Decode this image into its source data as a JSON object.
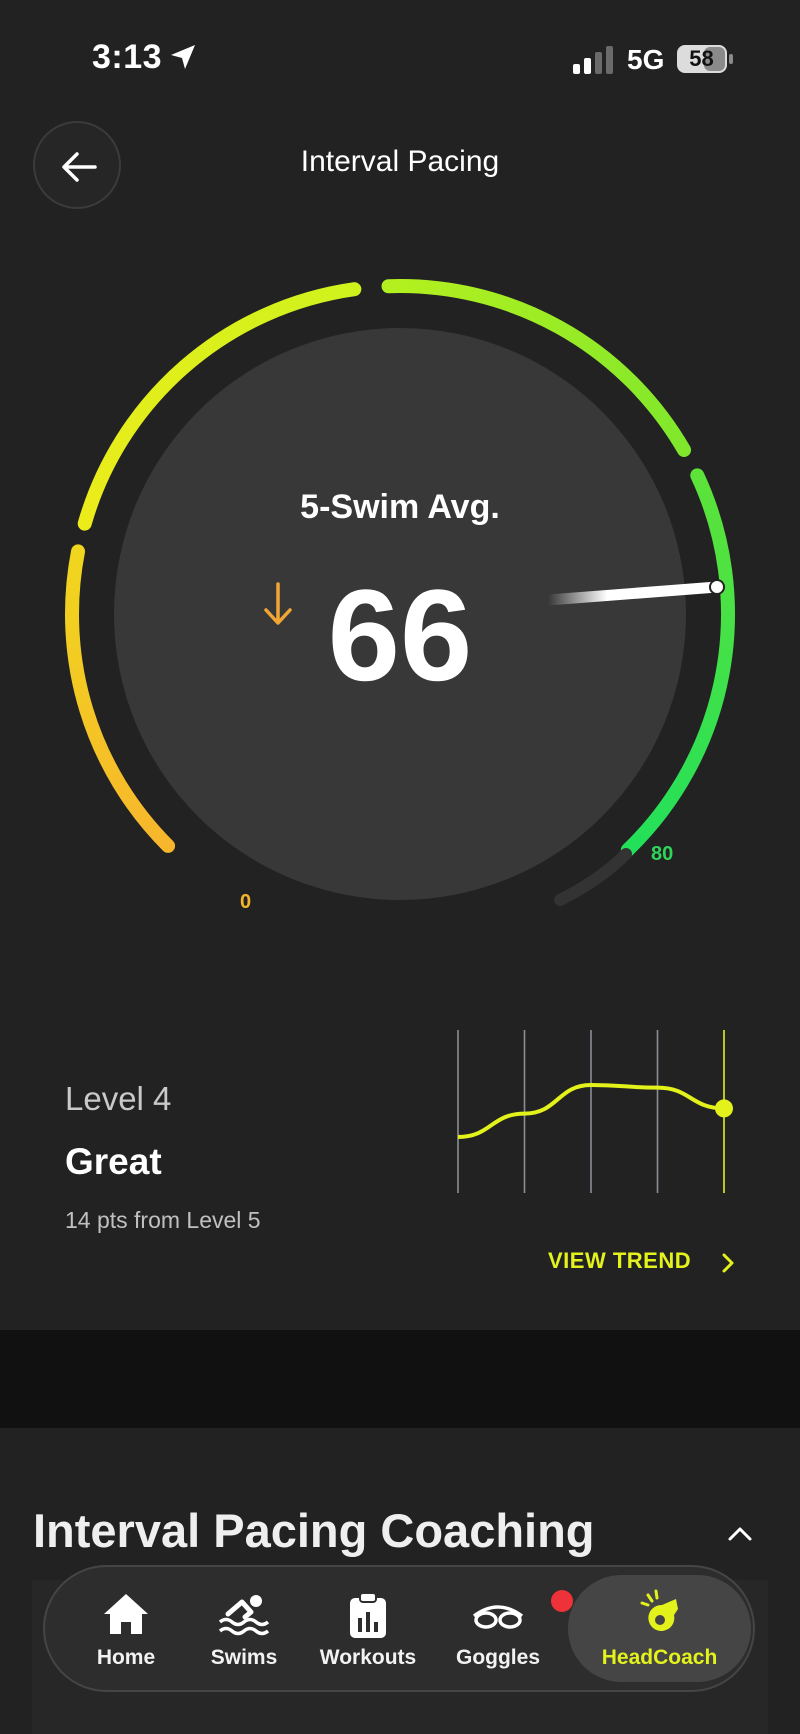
{
  "status_bar": {
    "time": "3:13",
    "network": "5G",
    "battery": "58"
  },
  "header": {
    "title": "Interval Pacing"
  },
  "gauge": {
    "label": "5-Swim Avg.",
    "value": "66",
    "min_label": "0",
    "max_label": "80",
    "trend": "down",
    "fraction_of_scale": 0.825,
    "colors": {
      "low": "#f7b62c",
      "mid": "#e6f51b",
      "high": "#22e05a",
      "needle": "#ffffff",
      "arrow": "#f3a534"
    }
  },
  "level": {
    "sublabel": "Level 4",
    "name": "Great",
    "points_to_next": "14 pts from Level 5"
  },
  "trend": {
    "link_label": "VIEW TREND",
    "points": [
      0.0,
      0.45,
      1.0,
      0.95,
      0.55
    ],
    "accent": "#e4f21c"
  },
  "coaching": {
    "title": "Interval Pacing Coaching"
  },
  "tabs": [
    {
      "label": "Home",
      "icon": "home-icon"
    },
    {
      "label": "Swims",
      "icon": "swimmer-icon"
    },
    {
      "label": "Workouts",
      "icon": "clipboard-chart-icon"
    },
    {
      "label": "Goggles",
      "icon": "goggles-icon"
    },
    {
      "label": "HeadCoach",
      "icon": "whistle-icon"
    }
  ]
}
